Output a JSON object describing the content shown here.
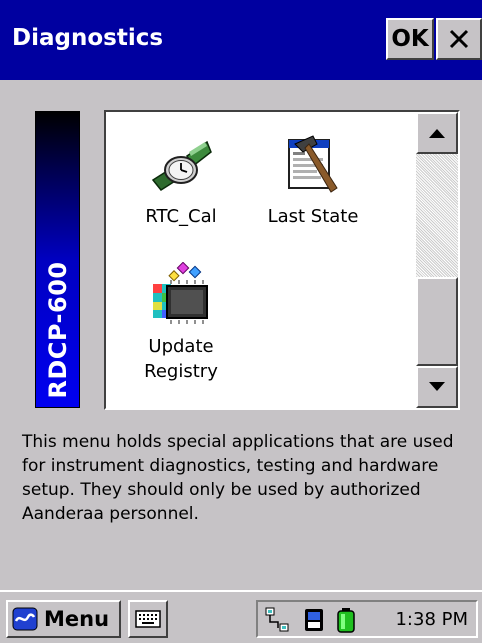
{
  "window": {
    "title": "Diagnostics",
    "ok_label": "OK",
    "close_label": "✕"
  },
  "banner": {
    "text": "RDCP-600"
  },
  "apps": [
    {
      "label": "RTC_Cal",
      "icon": "watch-icon"
    },
    {
      "label": "Last State",
      "icon": "hammer-document-icon"
    },
    {
      "label": "Update\nRegistry",
      "icon": "registry-chip-icon"
    }
  ],
  "description": "This menu holds special applications that are used for instrument diagnostics, testing and hardware setup. They should only be used by authorized Aanderaa personnel.",
  "taskbar": {
    "menu_label": "Menu",
    "clock": "1:38 PM"
  },
  "colors": {
    "titlebar": "#0000a0",
    "face": "#c6c3c6",
    "banner_text": "#ffffff"
  }
}
